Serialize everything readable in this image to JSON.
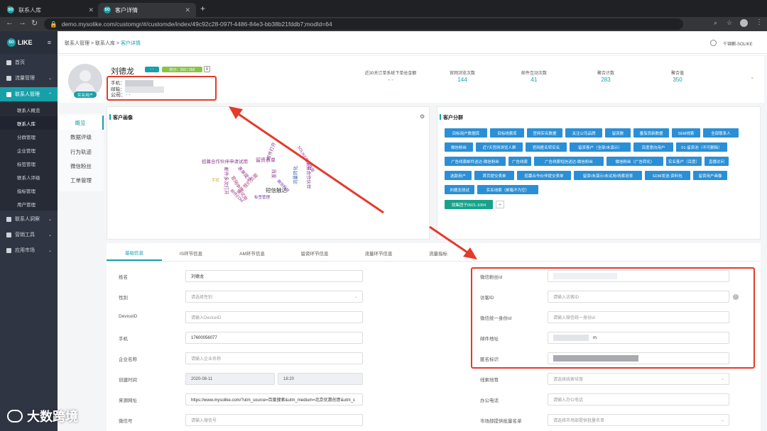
{
  "browser": {
    "tabs": [
      {
        "title": "联系人库"
      },
      {
        "title": "客户详情"
      }
    ],
    "url": "demo.mysolike.com/customgr/#/customde/index/49c92c28-097f-4486-84e3-bb38b21fddb7;modId=64",
    "favicon_text": "SO"
  },
  "logo": {
    "circle": "SO",
    "text": "LIKE"
  },
  "sidebar": {
    "items": [
      {
        "label": "首页"
      },
      {
        "label": "流量管理"
      },
      {
        "label": "联系人管理"
      }
    ],
    "sub_items": [
      {
        "label": "联系人概览"
      },
      {
        "label": "联系人库"
      },
      {
        "label": "分群管理"
      },
      {
        "label": "企业管理"
      },
      {
        "label": "标签管理"
      },
      {
        "label": "联系人评级"
      },
      {
        "label": "指标管理"
      },
      {
        "label": "用户管理"
      }
    ],
    "bottom_items": [
      {
        "label": "联系人洞察"
      },
      {
        "label": "营销工具"
      },
      {
        "label": "应用市场"
      }
    ]
  },
  "header": {
    "breadcrumb": "联系人管理 > 联系人库 > ",
    "breadcrumb_current": "客户详情",
    "user": "千锦麒-SOLIKE"
  },
  "profile": {
    "name": "刘德龙",
    "badge_dash": "- -",
    "score": "积分：350 / 350",
    "score_count": "0",
    "avatar_badge": "实名用户",
    "phone_label": "手机：",
    "email_label": "邮箱：",
    "company_label": "公司：",
    "company_value": "- -"
  },
  "stats": [
    {
      "label": "近30天订单系统下单总金额",
      "value": "- -"
    },
    {
      "label": "官网浏览次数",
      "value": "144"
    },
    {
      "label": "邮件互动次数",
      "value": "41"
    },
    {
      "label": "聚合计数",
      "value": "283"
    },
    {
      "label": "聚合值",
      "value": "350"
    }
  ],
  "left_menu": [
    {
      "label": "概览"
    },
    {
      "label": "数据评级"
    },
    {
      "label": "行为轨迹"
    },
    {
      "label": "微信粉丝"
    },
    {
      "label": "工单管理"
    }
  ],
  "portrait": {
    "title": "客户画像",
    "words": [
      {
        "text": "招募合作伙伴申请试用",
        "color": "#8e3a8e"
      },
      {
        "text": "留资表单",
        "color": "#8e3a8e"
      },
      {
        "text": "短信触达",
        "color": "#333"
      },
      {
        "text": "关于我们页面",
        "color": "#b0417a"
      },
      {
        "text": "官网申请试用",
        "color": "#b0417a"
      },
      {
        "text": "表单提交",
        "color": "#8e3a8e"
      },
      {
        "text": "百度",
        "color": "#8e3a8e"
      },
      {
        "text": "邮件打开",
        "color": "#8e3a8e"
      },
      {
        "text": "标签管理",
        "color": "#6a3ab0"
      },
      {
        "text": "邮件多次打开",
        "color": "#8e3a8e"
      },
      {
        "text": "SOLIKE营销页面",
        "color": "#a040a0"
      },
      {
        "text": "招募合作伙伴",
        "color": "#8e3a8e"
      },
      {
        "text": "流量转化",
        "color": "#3a6ab0"
      },
      {
        "text": "手机",
        "color": "#c8b43a"
      },
      {
        "text": "微信粉丝",
        "color": "#6a3ab0"
      },
      {
        "text": "邮件EDM",
        "color": "#8e3a8e"
      }
    ]
  },
  "segments": {
    "title": "客户分群",
    "tags": [
      "目标用户数据库",
      "目标线索库",
      "官网实名数据",
      "关注公司品牌",
      "留资数",
      "番茄员新数据",
      "SEM线索",
      "全部联系人",
      "微信粉丝",
      "近7天官网浏览人群",
      "官网匿名转实名",
      "留资客户（全部/未演示）",
      "百度意向用户",
      "01-留资池（不可删除）",
      "广告线索邮件送达-微信粉丝",
      "广告线索",
      "广告线索短信送达-微信粉丝",
      "微信粉丝（广告转化）",
      "实名客户（百度）",
      "直播访问",
      "选款用户",
      "首页提交表单",
      "招募合作伙伴提交表单",
      "留资/未演示/未试用/线索培育",
      "EDM发送-资料包",
      "留资用户画像",
      "刘德龙测试",
      "实名线索（邮箱不为空）",
      "就集团子0921-1004"
    ],
    "add": "+"
  },
  "form": {
    "tabs": [
      {
        "label": "基础信息"
      },
      {
        "label": "IS环节信息"
      },
      {
        "label": "AM环节信息"
      },
      {
        "label": "留资环节信息"
      },
      {
        "label": "流量环节信息"
      },
      {
        "label": "流量指标"
      }
    ],
    "left": [
      {
        "label": "姓名",
        "value": "刘德龙",
        "placeholder": ""
      },
      {
        "label": "性别",
        "value": "",
        "placeholder": "请选择性别"
      },
      {
        "label": "DeviceID",
        "value": "",
        "placeholder": "请输入DeviceID"
      },
      {
        "label": "手机",
        "value": "17600056077",
        "placeholder": ""
      },
      {
        "label": "企业名称",
        "value": "",
        "placeholder": "请输入企业名称"
      },
      {
        "label": "创建时间",
        "value": "2020-08-11",
        "value2": "18:20",
        "placeholder": ""
      },
      {
        "label": "来源网址",
        "value": "https://www.mysolike.com/?utm_source=百度搜索&utm_medium=北京优惠创意&utm_c",
        "placeholder": ""
      },
      {
        "label": "微信号",
        "value": "",
        "placeholder": "请输入微信号"
      }
    ],
    "right": [
      {
        "label": "微信粉丝id",
        "value": "",
        "placeholder": ""
      },
      {
        "label": "访客ID",
        "value": "",
        "placeholder": "请输入访客ID"
      },
      {
        "label": "微信统一身份id",
        "value": "",
        "placeholder": "请输入微信统一身份id"
      },
      {
        "label": "邮件地址",
        "value": "m",
        "placeholder": ""
      },
      {
        "label": "匿名标识",
        "value": "",
        "placeholder": ""
      },
      {
        "label": "线索培育",
        "value": "",
        "placeholder": "请选择线索培育"
      },
      {
        "label": "办公电话",
        "value": "",
        "placeholder": "请输入办公电话"
      },
      {
        "label": "市场部提供批量名单",
        "value": "",
        "placeholder": "请选择市场部提供批量名单"
      }
    ]
  },
  "watermark": "大数跨境",
  "colors": {
    "accent": "#18a0a8",
    "tag_blue": "#2a8fd6",
    "highlight_red": "#e63a2a",
    "sidebar": "#2f3542"
  }
}
